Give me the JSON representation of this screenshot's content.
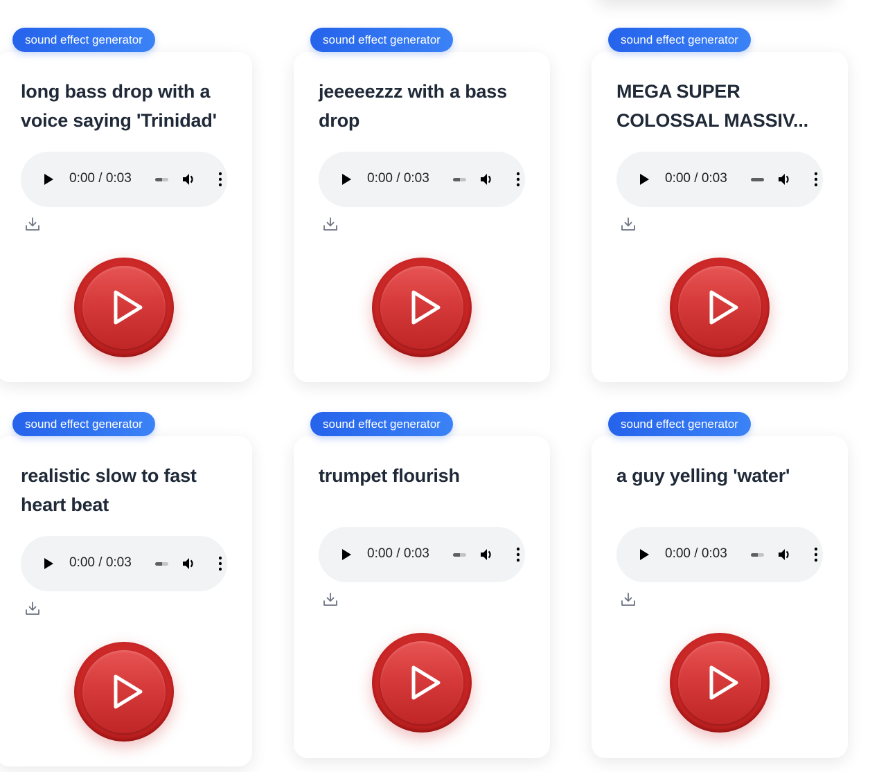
{
  "cards": [
    {
      "tag": "sound effect generator",
      "title_line1": "long bass drop with a",
      "title_line2": "voice saying 'Trinidad'",
      "time": "0:00 / 0:03",
      "progress": 0.5,
      "download_label": "download",
      "play_label": "play"
    },
    {
      "tag": "sound effect generator",
      "title_line1": "jeeeeezzz with a bass",
      "title_line2": "drop",
      "time": "0:00 / 0:03",
      "progress": 0.5,
      "download_label": "download",
      "play_label": "play"
    },
    {
      "tag": "sound effect generator",
      "title_line1": "MEGA SUPER",
      "title_line2": "COLOSSAL MASSIV...",
      "time": "0:00 / 0:03",
      "progress": 1.0,
      "download_label": "download",
      "play_label": "play"
    },
    {
      "tag": "sound effect generator",
      "title_line1": "realistic slow to fast",
      "title_line2": "heart beat",
      "time": "0:00 / 0:03",
      "progress": 0.5,
      "download_label": "download",
      "play_label": "play"
    },
    {
      "tag": "sound effect generator",
      "title_line1": "trumpet flourish",
      "title_line2": "",
      "time": "0:00 / 0:03",
      "progress": 0.5,
      "download_label": "download",
      "play_label": "play"
    },
    {
      "tag": "sound effect generator",
      "title_line1": "a guy yelling 'water'",
      "title_line2": "",
      "time": "0:00 / 0:03",
      "progress": 0.5,
      "download_label": "download",
      "play_label": "play"
    }
  ],
  "colors": {
    "tag_gradient_start": "#2563eb",
    "tag_gradient_end": "#3b82f6",
    "play_button_red": "#d32f2f",
    "title_text": "#1f2937"
  }
}
